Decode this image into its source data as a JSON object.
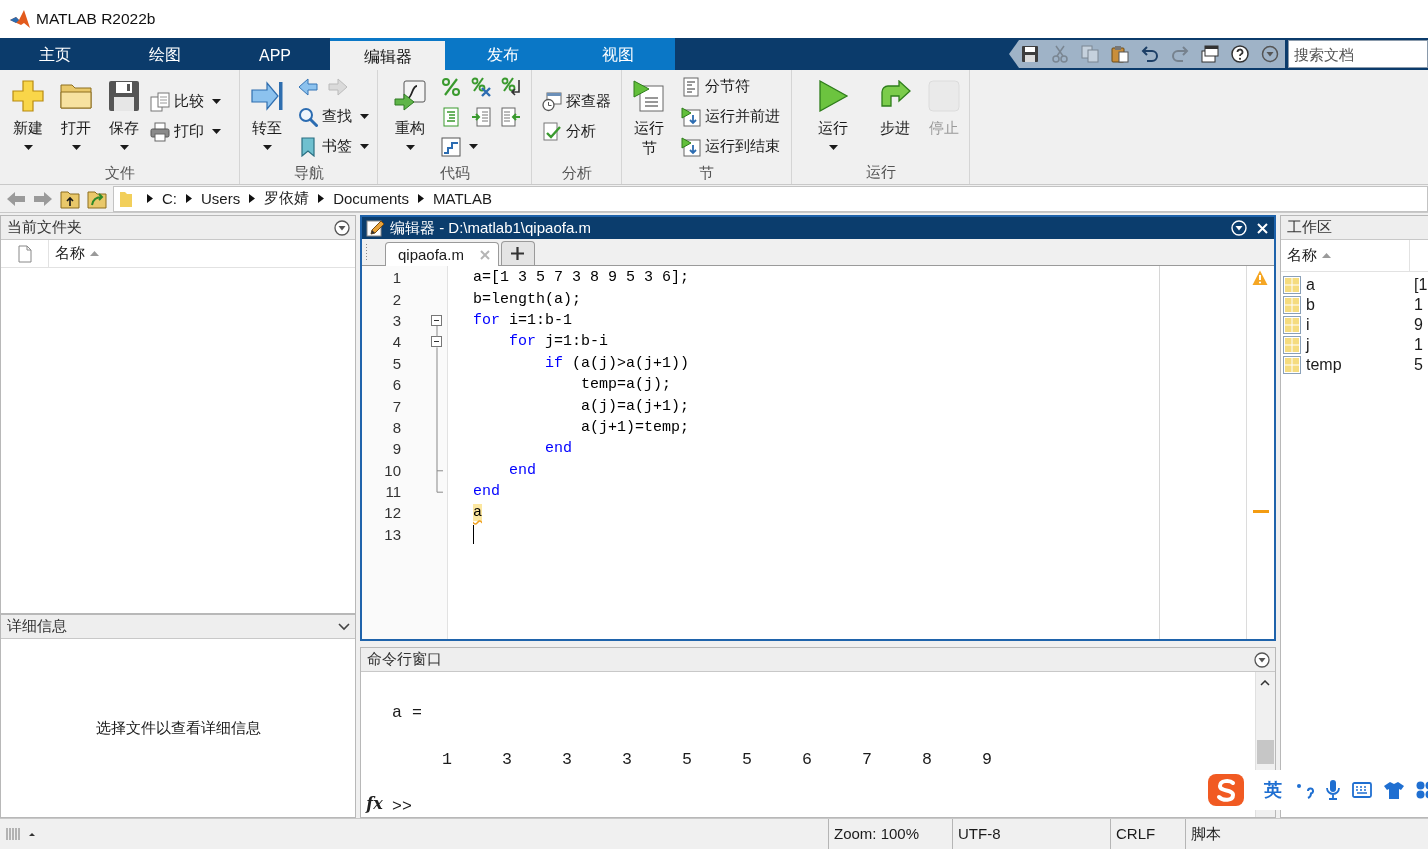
{
  "window": {
    "title": "MATLAB R2022b"
  },
  "tabs": [
    {
      "label": "主页",
      "kind": "global",
      "selected": false
    },
    {
      "label": "绘图",
      "kind": "global",
      "selected": false
    },
    {
      "label": "APP",
      "kind": "global",
      "selected": false
    },
    {
      "label": "编辑器",
      "kind": "context",
      "selected": true
    },
    {
      "label": "发布",
      "kind": "context",
      "selected": false
    },
    {
      "label": "视图",
      "kind": "context",
      "selected": false
    }
  ],
  "quick_access": [
    {
      "disabled": false
    },
    {
      "disabled": true
    },
    {
      "disabled": true
    },
    {
      "disabled": false
    },
    {
      "disabled": false
    },
    {
      "disabled": true
    },
    {
      "disabled": false
    },
    {
      "disabled": false
    },
    {
      "disabled": false
    }
  ],
  "search": {
    "placeholder": "搜索文档"
  },
  "ribbon": [
    {
      "label": "文件",
      "columns": [
        {
          "kind": "large",
          "label": "新建",
          "menu": true,
          "disabled": false
        },
        {
          "kind": "large",
          "label": "打开",
          "menu": true,
          "disabled": false
        },
        {
          "kind": "large",
          "label": "保存",
          "menu": true,
          "disabled": false
        },
        {
          "kind": "stack",
          "rows": [
            [
              {
                "label": "比较",
                "menu": true,
                "disabled": false
              }
            ],
            [
              {
                "label": "打印",
                "menu": true,
                "disabled": false
              }
            ]
          ]
        }
      ]
    },
    {
      "label": "导航",
      "columns": [
        {
          "kind": "large",
          "label": "转至",
          "menu": true,
          "disabled": false
        },
        {
          "kind": "stack",
          "rows": [
            [
              {
                "menu": false,
                "disabled": false
              },
              {
                "menu": false,
                "disabled": true
              }
            ],
            [
              {
                "label": "查找",
                "menu": true,
                "disabled": false
              }
            ],
            [
              {
                "label": "书签",
                "menu": true,
                "disabled": false
              }
            ]
          ]
        }
      ]
    },
    {
      "label": "代码",
      "columns": [
        {
          "kind": "large",
          "label": "重构",
          "menu": true,
          "disabled": false
        },
        {
          "kind": "stack",
          "rows": [
            [
              {
                "menu": false,
                "disabled": false
              },
              {
                "menu": false,
                "disabled": false
              },
              {
                "menu": false,
                "disabled": false
              }
            ],
            [
              {
                "menu": false,
                "disabled": false
              },
              {
                "menu": false,
                "disabled": false
              },
              {
                "menu": false,
                "disabled": false
              }
            ],
            [
              {
                "menu": true,
                "disabled": false
              }
            ]
          ]
        }
      ]
    },
    {
      "label": "分析",
      "columns": [
        {
          "kind": "stack",
          "rows": [
            [
              {
                "label": "探查器",
                "menu": false,
                "disabled": false
              }
            ],
            [
              {
                "label": "分析",
                "menu": false,
                "disabled": false
              }
            ]
          ]
        }
      ]
    },
    {
      "label": "节",
      "columns": [
        {
          "kind": "large",
          "label": "运行节",
          "menu": false,
          "disabled": false
        },
        {
          "kind": "stack",
          "rows": [
            [
              {
                "label": "分节符",
                "menu": false,
                "disabled": false
              }
            ],
            [
              {
                "label": "运行并前进",
                "menu": false,
                "disabled": false
              }
            ],
            [
              {
                "label": "运行到结束",
                "menu": false,
                "disabled": false
              }
            ]
          ]
        }
      ]
    },
    {
      "label": "运行",
      "columns": [
        {
          "kind": "large",
          "label": "运行",
          "menu": true,
          "disabled": false
        },
        {
          "kind": "large",
          "label": "步进",
          "menu": false,
          "disabled": false
        },
        {
          "kind": "large",
          "label": "停止",
          "menu": false,
          "disabled": true
        }
      ]
    }
  ],
  "address_path": [
    "C:",
    "Users",
    "罗依婧",
    "Documents",
    "MATLAB"
  ],
  "current_folder": {
    "title": "当前文件夹",
    "columns": [
      {
        "label": "名称",
        "sorted": true
      }
    ]
  },
  "details": {
    "title": "详细信息",
    "message": "选择文件以查看详细信息"
  },
  "editor": {
    "title": "编辑器 - D:\\matlab1\\qipaofa.m",
    "tabs": [
      {
        "label": "qipaofa.m",
        "selected": true
      }
    ],
    "lines": [
      {
        "number": "1",
        "foldable": false,
        "block_end": false,
        "warning": false,
        "cursor": false,
        "segments": [
          {
            "text": "a=[1 3 5 7 3 8 9 5 3 6];",
            "kind": "plain"
          }
        ]
      },
      {
        "number": "2",
        "foldable": false,
        "block_end": false,
        "warning": false,
        "cursor": false,
        "segments": [
          {
            "text": "b=length(a);",
            "kind": "plain"
          }
        ]
      },
      {
        "number": "3",
        "foldable": true,
        "block_end": false,
        "warning": false,
        "cursor": false,
        "segments": [
          {
            "text": "for",
            "kind": "keyword"
          },
          {
            "text": " i=1:b-1",
            "kind": "plain"
          }
        ]
      },
      {
        "number": "4",
        "foldable": true,
        "block_end": false,
        "warning": false,
        "cursor": false,
        "segments": [
          {
            "text": "    for",
            "kind": "keyword"
          },
          {
            "text": " j=1:b-i",
            "kind": "plain"
          }
        ]
      },
      {
        "number": "5",
        "foldable": false,
        "block_end": false,
        "warning": false,
        "cursor": false,
        "segments": [
          {
            "text": "        if",
            "kind": "keyword"
          },
          {
            "text": " (a(j)>a(j+1))",
            "kind": "plain"
          }
        ]
      },
      {
        "number": "6",
        "foldable": false,
        "block_end": false,
        "warning": false,
        "cursor": false,
        "segments": [
          {
            "text": "            temp=a(j);",
            "kind": "plain"
          }
        ]
      },
      {
        "number": "7",
        "foldable": false,
        "block_end": false,
        "warning": false,
        "cursor": false,
        "segments": [
          {
            "text": "            a(j)=a(j+1);",
            "kind": "plain"
          }
        ]
      },
      {
        "number": "8",
        "foldable": false,
        "block_end": false,
        "warning": false,
        "cursor": false,
        "segments": [
          {
            "text": "            a(j+1)=temp;",
            "kind": "plain"
          }
        ]
      },
      {
        "number": "9",
        "foldable": false,
        "block_end": false,
        "warning": false,
        "cursor": false,
        "segments": [
          {
            "text": "        end",
            "kind": "keyword"
          }
        ]
      },
      {
        "number": "10",
        "foldable": false,
        "block_end": true,
        "warning": false,
        "cursor": false,
        "segments": [
          {
            "text": "    end",
            "kind": "keyword"
          }
        ]
      },
      {
        "number": "11",
        "foldable": false,
        "block_end": true,
        "warning": false,
        "cursor": false,
        "segments": [
          {
            "text": "end",
            "kind": "keyword"
          }
        ]
      },
      {
        "number": "12",
        "foldable": false,
        "block_end": false,
        "warning": true,
        "cursor": false,
        "segments": [
          {
            "text": "a",
            "kind": "plain"
          }
        ]
      },
      {
        "number": "13",
        "foldable": false,
        "block_end": false,
        "warning": false,
        "cursor": true
      }
    ]
  },
  "command_window": {
    "title": "命令行窗口",
    "output": [
      {
        "kind": "text",
        "text": "a ="
      },
      {
        "kind": "values",
        "values": [
          "1",
          "3",
          "3",
          "3",
          "5",
          "5",
          "6",
          "7",
          "8",
          "9"
        ]
      }
    ],
    "function_button": "fx",
    "prompt": ">>"
  },
  "workspace": {
    "title": "工作区",
    "columns": [
      {
        "label": "名称",
        "sorted": true
      }
    ],
    "variables": [
      {
        "name": "a",
        "value": "[1"
      },
      {
        "name": "b",
        "value": "1"
      },
      {
        "name": "i",
        "value": "9"
      },
      {
        "name": "j",
        "value": "1"
      },
      {
        "name": "temp",
        "value": "5"
      }
    ]
  },
  "status_bar": [
    "Zoom: 100%",
    "UTF-8",
    "CRLF",
    "脚本"
  ],
  "ime_toolbar": {
    "mode": "英"
  }
}
